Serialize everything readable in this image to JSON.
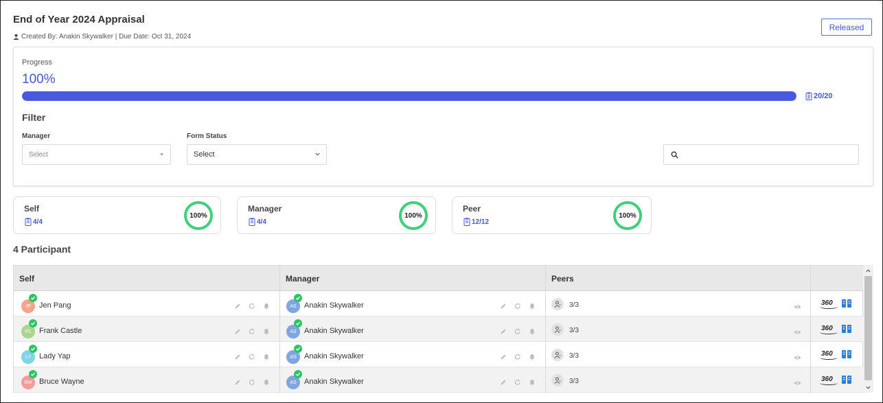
{
  "header": {
    "title": "End of Year 2024 Appraisal",
    "meta": "Created By: Anakin Skywalker | Due Date: Oct 31, 2024",
    "released_label": "Released"
  },
  "progress": {
    "label": "Progress",
    "value_text": "100%",
    "fraction": 1.0,
    "count": "20/20"
  },
  "filter": {
    "title": "Filter",
    "manager_label": "Manager",
    "manager_placeholder": "Select",
    "form_status_label": "Form Status",
    "form_status_value": "Select"
  },
  "stats": [
    {
      "name": "Self",
      "count": "4/4",
      "percent": "100%"
    },
    {
      "name": "Manager",
      "count": "4/4",
      "percent": "100%"
    },
    {
      "name": "Peer",
      "count": "12/12",
      "percent": "100%"
    }
  ],
  "participants_title": "4 Participant",
  "table": {
    "headers": [
      "Self",
      "Manager",
      "Peers",
      ""
    ],
    "rows": [
      {
        "initials": "JP",
        "self": "Jen Pang",
        "self_color": "#f9a48a",
        "mgr_initials": "AS",
        "manager": "Anakin Skywalker",
        "peers": "3/3"
      },
      {
        "initials": "FC",
        "self": "Frank Castle",
        "self_color": "#a9d68f",
        "mgr_initials": "AS",
        "manager": "Anakin Skywalker",
        "peers": "3/3"
      },
      {
        "initials": "LY",
        "self": "Lady Yap",
        "self_color": "#7fd4e6",
        "mgr_initials": "AS",
        "manager": "Anakin Skywalker",
        "peers": "3/3"
      },
      {
        "initials": "BW",
        "self": "Bruce Wayne",
        "self_color": "#f79a9a",
        "mgr_initials": "AS",
        "manager": "Anakin Skywalker",
        "peers": "3/3"
      }
    ],
    "icon_360_label": "360"
  },
  "colors": {
    "accent": "#4455d6",
    "progress_fill": "#4a5ae0",
    "ring": "#3fd17a",
    "check": "#2fc463",
    "manager_avatar": "#7ea6e0"
  }
}
